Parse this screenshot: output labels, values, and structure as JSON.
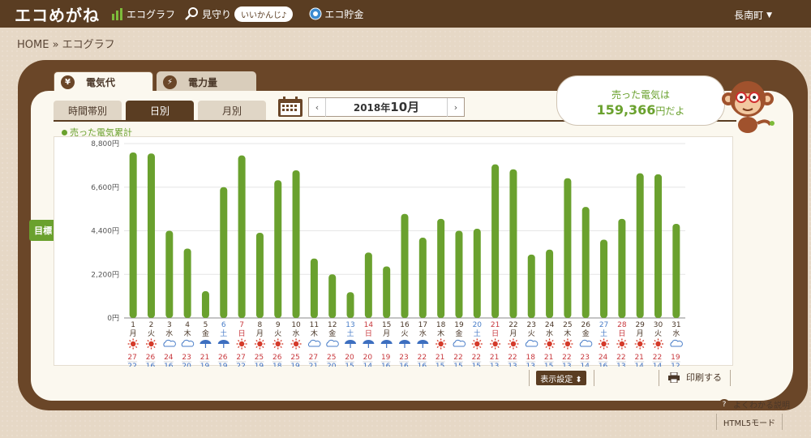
{
  "header": {
    "app_title": "エコめがね",
    "nav": [
      {
        "label": "エコグラフ",
        "icon": "bar-chart-icon"
      },
      {
        "label": "見守り",
        "icon": "magnifier-icon"
      },
      {
        "label": "エコ貯金",
        "icon": "coin-icon"
      }
    ],
    "badge": "いいかんじ♪",
    "user_menu": "長南町"
  },
  "breadcrumb": "HOME » エコグラフ",
  "tabs": {
    "cost": "電気代",
    "cost_icon_glyph": "¥",
    "power": "電力量",
    "power_icon_glyph": "⚡"
  },
  "subtabs": {
    "hour": "時間帯別",
    "day": "日別",
    "month": "月別"
  },
  "date_nav": {
    "prev": "‹",
    "year": "2018年",
    "month": "10月",
    "next": "›"
  },
  "bubble": {
    "line1": "売った電気は",
    "amount": "159,366",
    "suffix": "円だよ"
  },
  "target_button": "目標",
  "target_arrows": "⬍",
  "display_settings": "表示設定 ⬍",
  "print_label": "印刷する",
  "help_q": "?",
  "help_label": "よくわかる説明",
  "html5_label": "HTML5モード",
  "chart_data": {
    "type": "bar",
    "legend": "売った電気累計",
    "ylim": [
      0,
      8800
    ],
    "yticks": [
      "0円",
      "2,200円",
      "4,400円",
      "6,600円",
      "8,800円"
    ],
    "bar_color": "#6aa12e",
    "categories": [
      "1",
      "2",
      "3",
      "4",
      "5",
      "6",
      "7",
      "8",
      "9",
      "10",
      "11",
      "12",
      "13",
      "14",
      "15",
      "16",
      "17",
      "18",
      "19",
      "20",
      "21",
      "22",
      "23",
      "24",
      "25",
      "26",
      "27",
      "28",
      "29",
      "30",
      "31"
    ],
    "weekdays": [
      "月",
      "火",
      "水",
      "木",
      "金",
      "土",
      "日",
      "月",
      "火",
      "水",
      "木",
      "金",
      "土",
      "日",
      "月",
      "火",
      "水",
      "木",
      "金",
      "土",
      "日",
      "月",
      "火",
      "水",
      "木",
      "金",
      "土",
      "日",
      "月",
      "火",
      "水"
    ],
    "day_colors": {
      "土": "#4a7ec8",
      "日": "#c8383d",
      "default": "#4a3728"
    },
    "values": [
      8350,
      8300,
      4400,
      3500,
      1350,
      6600,
      8200,
      4300,
      6950,
      7450,
      3000,
      2200,
      1300,
      3300,
      2600,
      5250,
      4050,
      5000,
      4400,
      4500,
      7750,
      7500,
      3200,
      3450,
      7050,
      5600,
      3950,
      5000,
      7300,
      7250,
      4750
    ],
    "weather": [
      "sun",
      "sun",
      "cloud",
      "cloud",
      "rain",
      "rain",
      "sun",
      "sun",
      "sun",
      "sun",
      "cloud",
      "cloud",
      "rain",
      "rain",
      "rain",
      "rain",
      "rain",
      "sun",
      "cloud",
      "sun",
      "sun",
      "sun",
      "cloud",
      "sun",
      "sun",
      "cloud",
      "sun",
      "sun",
      "sun",
      "sun",
      "cloud"
    ],
    "temp_high": [
      "27",
      "26",
      "24",
      "23",
      "21",
      "26",
      "27",
      "25",
      "26",
      "25",
      "27",
      "25",
      "20",
      "20",
      "19",
      "23",
      "22",
      "21",
      "22",
      "22",
      "21",
      "22",
      "18",
      "21",
      "22",
      "23",
      "24",
      "22",
      "21",
      "22",
      "19"
    ],
    "temp_low": [
      "22",
      "16",
      "16",
      "20",
      "19",
      "19",
      "22",
      "19",
      "18",
      "19",
      "21",
      "20",
      "15",
      "14",
      "16",
      "16",
      "16",
      "15",
      "15",
      "15",
      "13",
      "13",
      "13",
      "15",
      "13",
      "14",
      "16",
      "13",
      "14",
      "14",
      "12"
    ]
  }
}
